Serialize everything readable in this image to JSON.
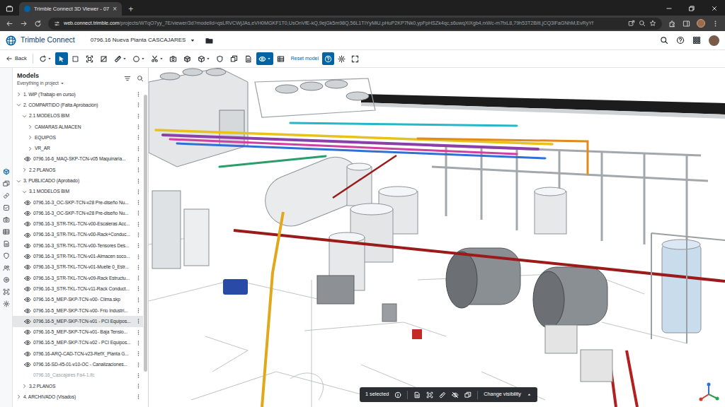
{
  "browser": {
    "tab_title": "Trimble Connect 3D Viewer - 07",
    "tab_close": "×",
    "new_tab": "+",
    "url_host": "web.connect.trimble.com",
    "url_path": "/projects/WTqO7yy_7E/viewer/3d?modelId=qsLRVCWjJAs,eVH0MGKF1T0,UsOnVfE-kQ,9ejGk5m98Q,56L1TIYyMiU,pHuP2KP7Nk0,ypFpHSZk4qc,s6uwqXiXgb4,rxWc-m7fxL8,79h53T2BItI,jCQ3lFaGNhM,EvRyYf"
  },
  "app": {
    "logo": "Trimble Connect",
    "project": "0796.16 Nueva Planta CASCAJARES"
  },
  "toolbar": {
    "back": "Back",
    "tools": [
      {
        "kind": "orbit",
        "dropdown": true,
        "selected": false
      },
      {
        "kind": "select",
        "dropdown": false,
        "selected": true
      },
      {
        "kind": "rect",
        "dropdown": false,
        "selected": false
      },
      {
        "kind": "frame",
        "dropdown": false,
        "selected": false
      },
      {
        "kind": "clip",
        "dropdown": false,
        "selected": false
      },
      {
        "kind": "measure",
        "dropdown": true,
        "selected": false
      },
      {
        "kind": "circle",
        "dropdown": true,
        "selected": false
      },
      {
        "kind": "cut",
        "dropdown": true,
        "selected": false
      },
      {
        "kind": "camera",
        "dropdown": false,
        "selected": false
      },
      {
        "kind": "box",
        "dropdown": false,
        "selected": false
      },
      {
        "kind": "cube",
        "dropdown": true,
        "selected": false
      },
      {
        "kind": "shield",
        "dropdown": false,
        "selected": false
      },
      {
        "kind": "layers",
        "dropdown": false,
        "selected": false
      },
      {
        "kind": "sheet",
        "dropdown": false,
        "selected": false
      },
      {
        "kind": "eye",
        "dropdown": true,
        "selected": true
      },
      {
        "kind": "table",
        "dropdown": false,
        "selected": false
      }
    ],
    "reset": "Reset model",
    "end_tools": [
      {
        "kind": "help",
        "selected": true
      },
      {
        "kind": "gear",
        "selected": false
      },
      {
        "kind": "full",
        "selected": false
      }
    ]
  },
  "rail": [
    {
      "kind": "box",
      "selected": true
    },
    {
      "kind": "layers",
      "selected": false
    },
    {
      "kind": "link",
      "selected": false
    },
    {
      "kind": "check",
      "selected": false
    },
    {
      "kind": "camera",
      "selected": false
    },
    {
      "kind": "table",
      "selected": false
    },
    {
      "kind": "sheet",
      "selected": false
    },
    {
      "kind": "shield",
      "selected": false
    },
    {
      "kind": "users",
      "selected": false
    },
    {
      "kind": "target",
      "selected": false
    },
    {
      "kind": "frame",
      "selected": false
    },
    {
      "kind": "gear",
      "selected": false
    }
  ],
  "models": {
    "title": "Models",
    "filter": "Everything in project",
    "tree": [
      {
        "label": "1. WIP (Trabajo en curso)",
        "kind": "group",
        "depth": 0,
        "expanded": false,
        "selected": false
      },
      {
        "label": "2. COMPARTIDO (Falta Aprobación)",
        "kind": "group",
        "depth": 0,
        "expanded": true,
        "selected": false
      },
      {
        "label": "2.1 MODELOS BIM",
        "kind": "group",
        "depth": 1,
        "expanded": true,
        "selected": false
      },
      {
        "label": "CAMARAS ALMACEN",
        "kind": "group",
        "depth": 2,
        "expanded": false,
        "selected": false
      },
      {
        "label": "EQUIPOS",
        "kind": "group",
        "depth": 2,
        "expanded": false,
        "selected": false
      },
      {
        "label": "VR_AR",
        "kind": "group",
        "depth": 2,
        "expanded": false,
        "selected": false
      },
      {
        "label": "0796.16-6_MAQ-SKP-TCN-v05 Maquinaria...",
        "kind": "model",
        "depth": 2,
        "visible": true,
        "selected": false
      },
      {
        "label": "2.2 PLANOS",
        "kind": "group",
        "depth": 1,
        "expanded": false,
        "selected": false
      },
      {
        "label": "3. PUBLICADO (Aprobado)",
        "kind": "group",
        "depth": 0,
        "expanded": true,
        "selected": false
      },
      {
        "label": "3.1 MODELOS BIM",
        "kind": "group",
        "depth": 1,
        "expanded": true,
        "selected": false
      },
      {
        "label": "0796.16-3_OC-SKP-TCN-v28 Pre-diseño Nu...",
        "kind": "model",
        "depth": 2,
        "visible": true,
        "selected": false
      },
      {
        "label": "0796.16-3_OC-SKP-TCN-v28 Pre-diseño Nu...",
        "kind": "model",
        "depth": 2,
        "visible": true,
        "selected": false
      },
      {
        "label": "0796.16-3_STR-TKL-TCN-v00-Escaleras Acc...",
        "kind": "model",
        "depth": 2,
        "visible": true,
        "selected": false
      },
      {
        "label": "0796.16-3_STR-TKL-TCN-v00-Rack+Conduc...",
        "kind": "model",
        "depth": 2,
        "visible": true,
        "selected": false
      },
      {
        "label": "0796.16-3_STR-TKL-TCN-v00-Tensores Des...",
        "kind": "model",
        "depth": 2,
        "visible": true,
        "selected": false
      },
      {
        "label": "0796.16-3_STR-TKL-TCN-v01-Almacen soco...",
        "kind": "model",
        "depth": 2,
        "visible": true,
        "selected": false
      },
      {
        "label": "0796.16-3_STR-TKL-TCN-v01-Muelle 0_Estr...",
        "kind": "model",
        "depth": 2,
        "visible": true,
        "selected": false
      },
      {
        "label": "0796.16-3_STR-TKL-TCN-v09-Rack Estructu...",
        "kind": "model",
        "depth": 2,
        "visible": true,
        "selected": false
      },
      {
        "label": "0796.16-3_STR-TKL-TCN-v11-Rack Conduct...",
        "kind": "model",
        "depth": 2,
        "visible": true,
        "selected": false
      },
      {
        "label": "0796.16-5_MEP-SKP-TCN-v00- Clima.skp",
        "kind": "model",
        "depth": 2,
        "visible": true,
        "selected": false
      },
      {
        "label": "0796.16-5_MEP-SKP-TCN-v00- Frio Industri...",
        "kind": "model",
        "depth": 2,
        "visible": true,
        "selected": false
      },
      {
        "label": "0796.16-5_MEP-SKP-TCN-v01 - PCI Equipos...",
        "kind": "model",
        "depth": 2,
        "visible": true,
        "selected": true
      },
      {
        "label": "0796.16-5_MEP-SKP-TCN-v01- Baja Tensio...",
        "kind": "model",
        "depth": 2,
        "visible": true,
        "selected": false
      },
      {
        "label": "0796.16-5_MEP-SKP-TCN-v02 - PCI Equipos...",
        "kind": "model",
        "depth": 2,
        "visible": true,
        "selected": false
      },
      {
        "label": "0796.16-ARQ-CAD-TCN-v23-RefX_Planta G...",
        "kind": "model",
        "depth": 2,
        "visible": true,
        "selected": false
      },
      {
        "label": "0796.16-SD-45-01-v10-OC - Canalizaciones...",
        "kind": "model",
        "depth": 2,
        "visible": true,
        "selected": false
      },
      {
        "label": "0796.16_Cascajares Fa4-1.ifc",
        "kind": "model",
        "depth": 2,
        "visible": false,
        "selected": false
      },
      {
        "label": "3.2 PLANOS",
        "kind": "group",
        "depth": 1,
        "expanded": false,
        "selected": false
      },
      {
        "label": "4. ARCHIVADO (Visados)",
        "kind": "group",
        "depth": 0,
        "expanded": false,
        "selected": false
      }
    ]
  },
  "selection_bar": {
    "count": "1 selected",
    "action": "Change visibility"
  }
}
